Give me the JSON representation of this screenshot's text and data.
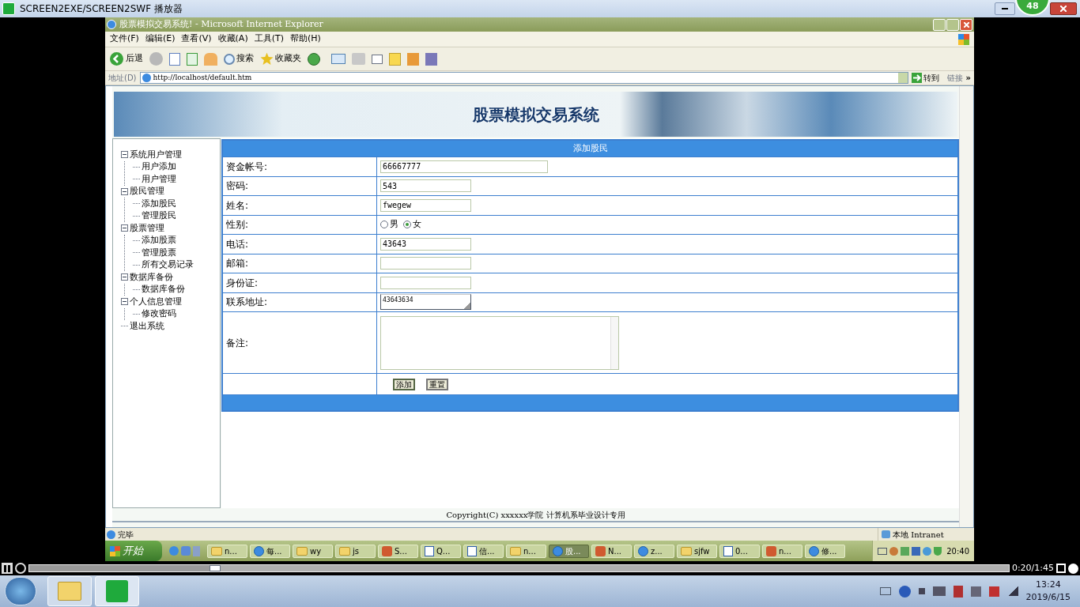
{
  "player_window": {
    "title": "SCREEN2EXE/SCREEN2SWF 播放器",
    "badge": "48"
  },
  "ie": {
    "title": "股票模拟交易系统! - Microsoft Internet Explorer",
    "menu": [
      "文件(F)",
      "编辑(E)",
      "查看(V)",
      "收藏(A)",
      "工具(T)",
      "帮助(H)"
    ],
    "toolbar": {
      "back": "后退",
      "search": "搜索",
      "favorites": "收藏夹"
    },
    "address": {
      "label": "地址(D)",
      "url": "http://localhost/default.htm",
      "go": "转到",
      "links": "链接",
      "more": "»"
    },
    "status": {
      "text": "完毕",
      "zone": "本地 Intranet"
    }
  },
  "page": {
    "banner_title": "股票模拟交易系统",
    "sidebar": [
      {
        "label": "系统用户管理",
        "expanded": true,
        "children": [
          {
            "label": "用户添加"
          },
          {
            "label": "用户管理"
          }
        ]
      },
      {
        "label": "股民管理",
        "expanded": true,
        "children": [
          {
            "label": "添加股民"
          },
          {
            "label": "管理股民"
          }
        ]
      },
      {
        "label": "股票管理",
        "expanded": true,
        "children": [
          {
            "label": "添加股票"
          },
          {
            "label": "管理股票"
          },
          {
            "label": "所有交易记录"
          }
        ]
      },
      {
        "label": "数据库备份",
        "expanded": true,
        "children": [
          {
            "label": "数据库备份"
          }
        ]
      },
      {
        "label": "个人信息管理",
        "expanded": true,
        "children": [
          {
            "label": "修改密码"
          }
        ]
      },
      {
        "label": "退出系统"
      }
    ],
    "form": {
      "title": "添加股民",
      "rows": [
        {
          "kind": "input",
          "label": "资金帐号:",
          "value": "66667777",
          "wide": true
        },
        {
          "kind": "input",
          "label": "密码:",
          "value": "543",
          "wide": false
        },
        {
          "kind": "input",
          "label": "姓名:",
          "value": "fwegew",
          "wide": false
        },
        {
          "kind": "radio",
          "label": "性别:",
          "options": [
            {
              "label": "男",
              "selected": false
            },
            {
              "label": "女",
              "selected": true
            }
          ]
        },
        {
          "kind": "input",
          "label": "电话:",
          "value": "43643",
          "wide": false
        },
        {
          "kind": "input",
          "label": "邮箱:",
          "wide": false
        },
        {
          "kind": "input",
          "label": "身份证:",
          "wide": false
        },
        {
          "kind": "memo",
          "label": "联系地址:",
          "value": "43643634"
        },
        {
          "kind": "textarea",
          "label": "备注:"
        },
        {
          "kind": "buttons",
          "buttons": [
            "添加",
            "重置"
          ]
        }
      ]
    },
    "footer": "Copyright(C) xxxxxx学院 计算机系毕业设计专用"
  },
  "xp_taskbar": {
    "start": "开始",
    "tasks": [
      {
        "label": "n...",
        "kind": "folder",
        "selected": false
      },
      {
        "label": "每...",
        "kind": "browser",
        "selected": false
      },
      {
        "label": "wy",
        "kind": "folder",
        "selected": false
      },
      {
        "label": "js",
        "kind": "folder",
        "selected": false
      },
      {
        "label": "S...",
        "kind": "app",
        "selected": false
      },
      {
        "label": "Q...",
        "kind": "document",
        "selected": false
      },
      {
        "label": "信...",
        "kind": "document",
        "selected": false
      },
      {
        "label": "n...",
        "kind": "folder",
        "selected": false
      },
      {
        "label": "股...",
        "kind": "browser",
        "selected": true
      },
      {
        "label": "N...",
        "kind": "app",
        "selected": false
      },
      {
        "label": "z...",
        "kind": "browser",
        "selected": false
      },
      {
        "label": "sjfw",
        "kind": "folder",
        "selected": false
      },
      {
        "label": "0...",
        "kind": "document",
        "selected": false
      },
      {
        "label": "n...",
        "kind": "app",
        "selected": false
      },
      {
        "label": "修...",
        "kind": "browser",
        "selected": false
      }
    ],
    "clock": "20:40"
  },
  "player": {
    "level": 0.19,
    "time": "0:20/1:45"
  },
  "win7_taskbar": {
    "time": "13:24",
    "date": "2019/6/15"
  }
}
